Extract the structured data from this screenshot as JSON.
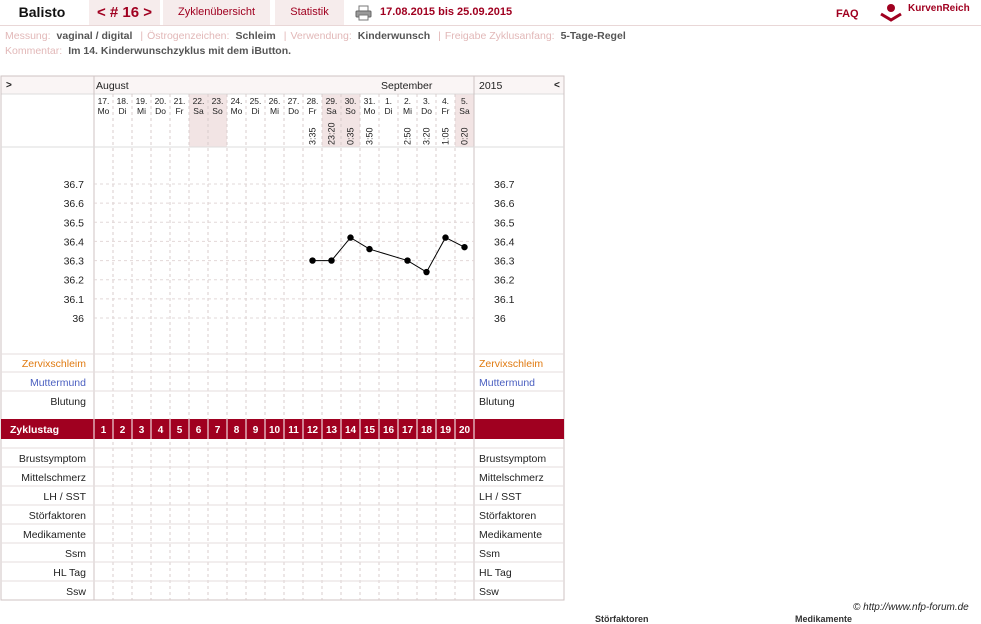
{
  "topbar": {
    "name": "Balisto",
    "cycle": "< # 16 >",
    "overview": "Zyklenübersicht",
    "stats": "Statistik",
    "date_range": "17.08.2015 bis 25.09.2015",
    "faq": "FAQ",
    "brand": "KurvenReich",
    "icons": [
      "printer-icon",
      "kurvenreich-logo-icon"
    ]
  },
  "info": {
    "messung_label": "Messung:",
    "messung_value": "vaginal / digital",
    "oestrogen_label": "Östrogenzeichen:",
    "oestrogen_value": "Schleim",
    "verwendung_label": "Verwendung:",
    "verwendung_value": "Kinderwunsch",
    "freigabe_label": "Freigabe Zyklusanfang:",
    "freigabe_value": "5-Tage-Regel",
    "kommentar_label": "Kommentar:",
    "kommentar_value": "Im 14. Kinderwunschzyklus mit dem iButton."
  },
  "nav": {
    "left": ">",
    "right": "<"
  },
  "months": {
    "august": "August",
    "september": "September",
    "year": "2015"
  },
  "chart_data": {
    "type": "line",
    "days": [
      {
        "date": "17.",
        "wd": "Mo",
        "time": "",
        "cd": "1",
        "weekend": false
      },
      {
        "date": "18.",
        "wd": "Di",
        "time": "",
        "cd": "2",
        "weekend": false
      },
      {
        "date": "19.",
        "wd": "Mi",
        "time": "",
        "cd": "3",
        "weekend": false
      },
      {
        "date": "20.",
        "wd": "Do",
        "time": "",
        "cd": "4",
        "weekend": false
      },
      {
        "date": "21.",
        "wd": "Fr",
        "time": "",
        "cd": "5",
        "weekend": false
      },
      {
        "date": "22.",
        "wd": "Sa",
        "time": "",
        "cd": "6",
        "weekend": true
      },
      {
        "date": "23.",
        "wd": "So",
        "time": "",
        "cd": "7",
        "weekend": true
      },
      {
        "date": "24.",
        "wd": "Mo",
        "time": "",
        "cd": "8",
        "weekend": false
      },
      {
        "date": "25.",
        "wd": "Di",
        "time": "",
        "cd": "9",
        "weekend": false
      },
      {
        "date": "26.",
        "wd": "Mi",
        "time": "",
        "cd": "10",
        "weekend": false
      },
      {
        "date": "27.",
        "wd": "Do",
        "time": "",
        "cd": "11",
        "weekend": false
      },
      {
        "date": "28.",
        "wd": "Fr",
        "time": "3:35",
        "cd": "12",
        "weekend": false
      },
      {
        "date": "29.",
        "wd": "Sa",
        "time": "23:20",
        "cd": "13",
        "weekend": true
      },
      {
        "date": "30.",
        "wd": "So",
        "time": "0:35",
        "cd": "14",
        "weekend": true
      },
      {
        "date": "31.",
        "wd": "Mo",
        "time": "3:50",
        "cd": "15",
        "weekend": false
      },
      {
        "date": "1.",
        "wd": "Di",
        "time": "",
        "cd": "16",
        "weekend": false
      },
      {
        "date": "2.",
        "wd": "Mi",
        "time": "2:50",
        "cd": "17",
        "weekend": false
      },
      {
        "date": "3.",
        "wd": "Do",
        "time": "3:20",
        "cd": "18",
        "weekend": false
      },
      {
        "date": "4.",
        "wd": "Fr",
        "time": "1:05",
        "cd": "19",
        "weekend": false
      },
      {
        "date": "5.",
        "wd": "Sa",
        "time": "0:20",
        "cd": "20",
        "weekend": true
      }
    ],
    "temps": [
      null,
      null,
      null,
      null,
      null,
      null,
      null,
      null,
      null,
      null,
      null,
      36.3,
      36.3,
      36.42,
      36.36,
      null,
      36.3,
      36.24,
      36.42,
      36.37
    ],
    "ylim": [
      36.0,
      36.7
    ],
    "yticks": [
      "36.7",
      "36.6",
      "36.5",
      "36.4",
      "36.3",
      "36.2",
      "36.1",
      "36"
    ],
    "color_line": "#000000",
    "color_weekend": "#f2e4e4",
    "color_cycleday": "#a00020",
    "grid": true
  },
  "rows": {
    "zervix": "Zervixschleim",
    "muttermund": "Muttermund",
    "blutung": "Blutung",
    "zyklustag": "Zyklustag",
    "lower": [
      "Brustsymptom",
      "Mittelschmerz",
      "LH / SST",
      "Störfaktoren",
      "Medikamente",
      "Ssm",
      "HL Tag",
      "Ssw"
    ],
    "zervix_color": "#e07a10",
    "muttermund_color": "#4a5fc0"
  },
  "footer": {
    "credit": "© http://www.nfp-forum.de",
    "clip_left": "Störfaktoren",
    "clip_right": "Medikamente"
  }
}
